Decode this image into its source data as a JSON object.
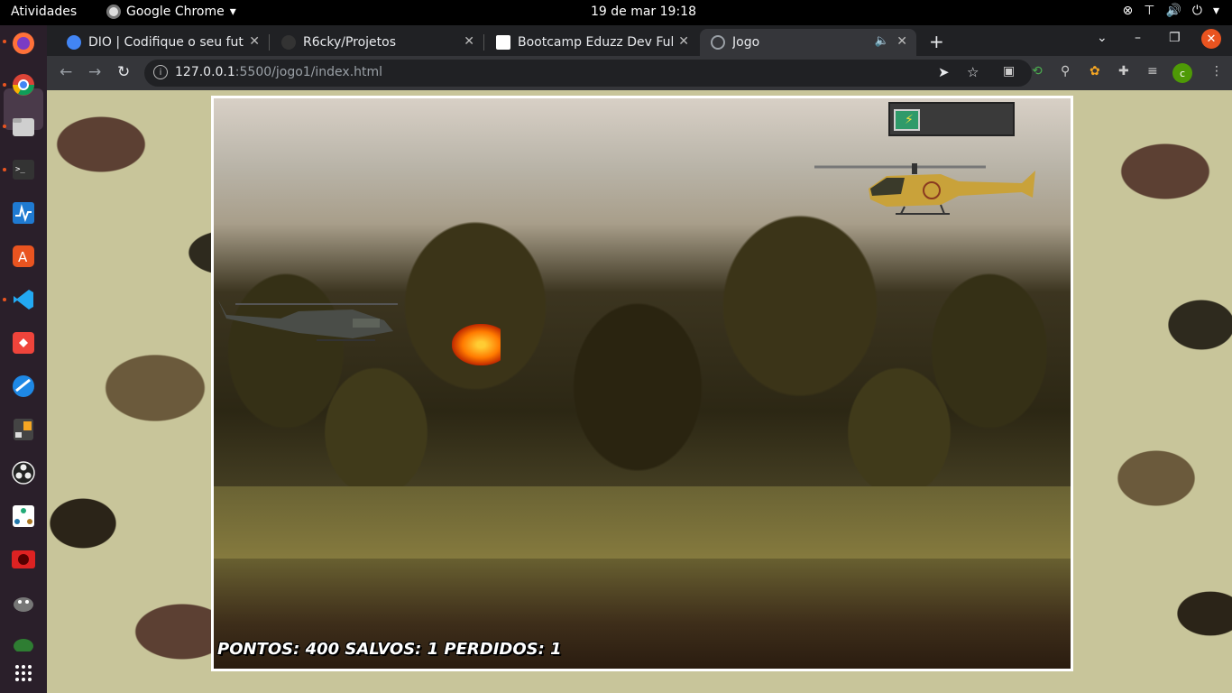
{
  "system": {
    "activities": "Atividades",
    "app_name": "Google Chrome",
    "clock": "19 de mar  19:18"
  },
  "browser": {
    "tabs": [
      {
        "label": "DIO | Codifique o seu futu",
        "icon_color": "#4285f4"
      },
      {
        "label": "R6cky/Projetos",
        "icon_color": "#333333"
      },
      {
        "label": "Bootcamp Eduzz Dev Fullst",
        "icon_color": "#ffffff"
      },
      {
        "label": "Jogo",
        "icon_color": "#9aa0a6"
      }
    ],
    "url_host": "127.0.0.1",
    "url_rest": ":5500/jogo1/index.html",
    "profile_initial": "c"
  },
  "game": {
    "hud": "PONTOS: 400 SALVOS: 1 PERDIDOS: 1",
    "fuel_level": 0.23
  },
  "colors": {
    "accent": "#e95420",
    "camo_base": "#c8c59a"
  }
}
